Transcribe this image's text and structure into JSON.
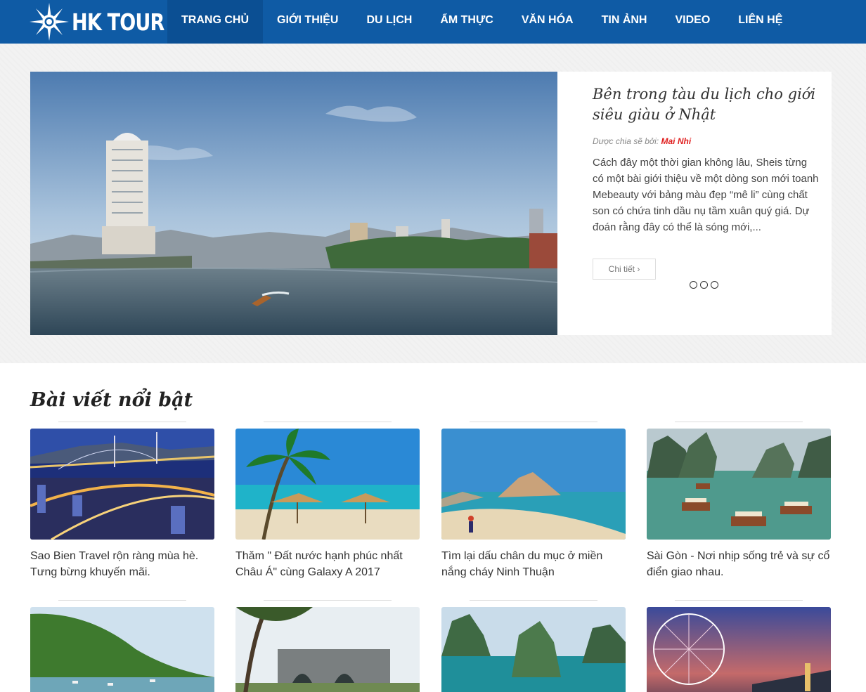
{
  "brand": {
    "name": "HK TOUR",
    "color": "#0f5ba5",
    "icon": "sun-icon"
  },
  "nav": [
    {
      "label": "TRANG CHỦ",
      "active": true
    },
    {
      "label": "GIỚI THIỆU"
    },
    {
      "label": "DU LỊCH"
    },
    {
      "label": "ẨM THỰC"
    },
    {
      "label": "VĂN HÓA"
    },
    {
      "label": "TIN ẢNH"
    },
    {
      "label": "VIDEO"
    },
    {
      "label": "LIÊN HỆ"
    }
  ],
  "hero": {
    "title": "Bên trong tàu du lịch cho giới siêu giàu ở Nhật",
    "byline_prefix": "Dược chia sẽ bởi:",
    "author": "Mai Nhi",
    "excerpt": "Cách đây một thời gian không lâu, Sheis từng có một bài giới thiệu về một dòng son mới toanh Mebeauty với bảng màu đẹp “mê li” cùng chất son có chứa tinh dầu nụ tầm xuân quý giá. Dự đoán rằng đây có thể là sóng mới,...",
    "button_label": "Chi tiết ›",
    "slides": 3,
    "author_color": "#e02020"
  },
  "featured": {
    "title": "Bài viết nổi bật",
    "row1": [
      {
        "title": "Sao Bien Travel rộn ràng mùa hè. Tưng bừng khuyến mãi.",
        "image": "night-bridge-photo"
      },
      {
        "title": "Thăm \" Đất nước hạnh phúc nhất Châu Á\" cùng Galaxy A 2017",
        "image": "tropical-beach-photo"
      },
      {
        "title": "Tìm lại dấu chân du mục ở miền nắng cháy Ninh Thuận",
        "image": "rocky-coast-photo"
      },
      {
        "title": "Sài Gòn - Nơi nhịp sống trẻ và sự cổ điển giao nhau.",
        "image": "halong-bay-boats-photo"
      }
    ],
    "row2": [
      {
        "image": "green-hill-bay-photo"
      },
      {
        "image": "citadel-gate-photo"
      },
      {
        "image": "limestone-islands-photo"
      },
      {
        "image": "ferris-wheel-photo"
      }
    ]
  }
}
